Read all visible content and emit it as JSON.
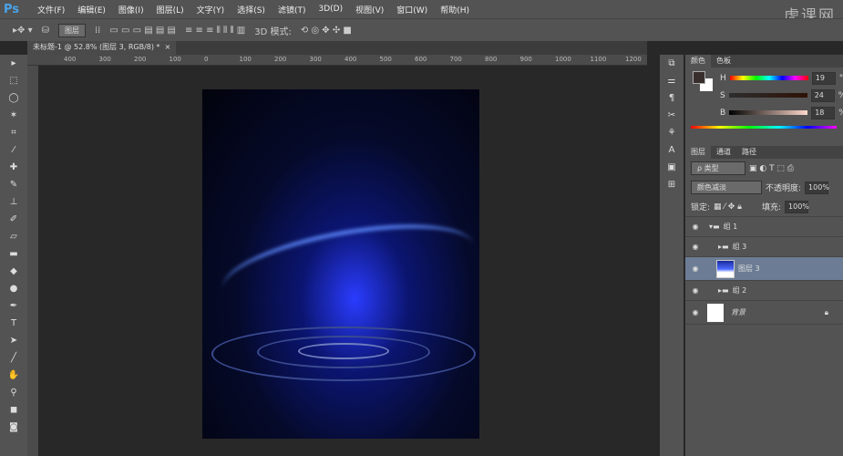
{
  "app": {
    "logo": "Ps",
    "watermark": "虎课网"
  },
  "menu": [
    "文件(F)",
    "编辑(E)",
    "图像(I)",
    "图层(L)",
    "文字(Y)",
    "选择(S)",
    "滤镜(T)",
    "3D(D)",
    "视图(V)",
    "窗口(W)",
    "帮助(H)"
  ],
  "options": {
    "auto_select": "图层",
    "mode_label": "3D 模式:"
  },
  "document": {
    "tab": "未标题-1 @ 52.8% (图层 3, RGB/8) *",
    "close": "×"
  },
  "ruler": [
    "400",
    "300",
    "200",
    "100",
    "0",
    "100",
    "200",
    "300",
    "400",
    "500",
    "600",
    "700",
    "800",
    "900",
    "1000",
    "1100",
    "1200"
  ],
  "color_panel": {
    "tabs": [
      "颜色",
      "色板"
    ],
    "h": {
      "label": "H",
      "value": "19",
      "unit": "°"
    },
    "s": {
      "label": "S",
      "value": "24",
      "unit": "%"
    },
    "b": {
      "label": "B",
      "value": "18",
      "unit": "%"
    },
    "foreground": "#382f2c",
    "background": "#ffffff"
  },
  "layers_panel": {
    "tabs": [
      "图层",
      "通道",
      "路径"
    ],
    "filter": "ρ 类型",
    "blend_mode": "颜色减淡",
    "opacity_label": "不透明度:",
    "opacity": "100%",
    "lock_label": "锁定:",
    "fill_label": "填充:",
    "fill": "100%",
    "layers": [
      {
        "name": "组 1",
        "type": "group",
        "expanded": true,
        "indent": 0
      },
      {
        "name": "组 3",
        "type": "group",
        "indent": 1
      },
      {
        "name": "图层 3",
        "type": "layer",
        "selected": true,
        "indent": 1
      },
      {
        "name": "组 2",
        "type": "group",
        "indent": 1
      },
      {
        "name": "背景",
        "type": "background",
        "locked": true,
        "indent": 0
      }
    ]
  }
}
